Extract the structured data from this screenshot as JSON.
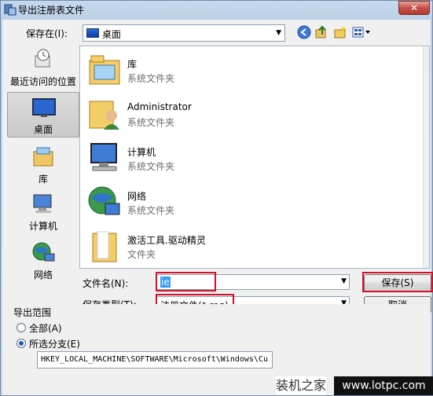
{
  "window": {
    "title": "导出注册表文件",
    "close_symbol": "✕"
  },
  "location": {
    "label": "保存在(I):",
    "value": "桌面"
  },
  "toolbar": {
    "back_icon": "back-icon",
    "up_icon": "up-folder-icon",
    "new_folder_icon": "new-folder-icon",
    "views_icon": "views-menu-icon"
  },
  "places": [
    {
      "label": "最近访问的位置"
    },
    {
      "label": "桌面"
    },
    {
      "label": "库"
    },
    {
      "label": "计算机"
    },
    {
      "label": "网络"
    }
  ],
  "files": [
    {
      "name": "库",
      "type": "系统文件夹"
    },
    {
      "name": "Administrator",
      "type": "系统文件夹"
    },
    {
      "name": "计算机",
      "type": "系统文件夹"
    },
    {
      "name": "网络",
      "type": "系统文件夹"
    },
    {
      "name": "激活工具.驱动精灵",
      "type": "文件夹"
    }
  ],
  "filename": {
    "label": "文件名(N):",
    "value": "ie"
  },
  "filetype": {
    "label": "保存类型(T):",
    "value": "注册文件(*.reg)"
  },
  "buttons": {
    "save": "保存(S)",
    "cancel": "取消"
  },
  "export": {
    "group_label": "导出范围",
    "all_label": "全部(A)",
    "branch_label": "所选分支(E)",
    "selected": "branch",
    "key_path": "HKEY_LOCAL_MACHINE\\SOFTWARE\\Microsoft\\Windows\\Cu"
  },
  "watermark": {
    "left_text": "装机之家",
    "right_text": "www.lotpc.com"
  }
}
